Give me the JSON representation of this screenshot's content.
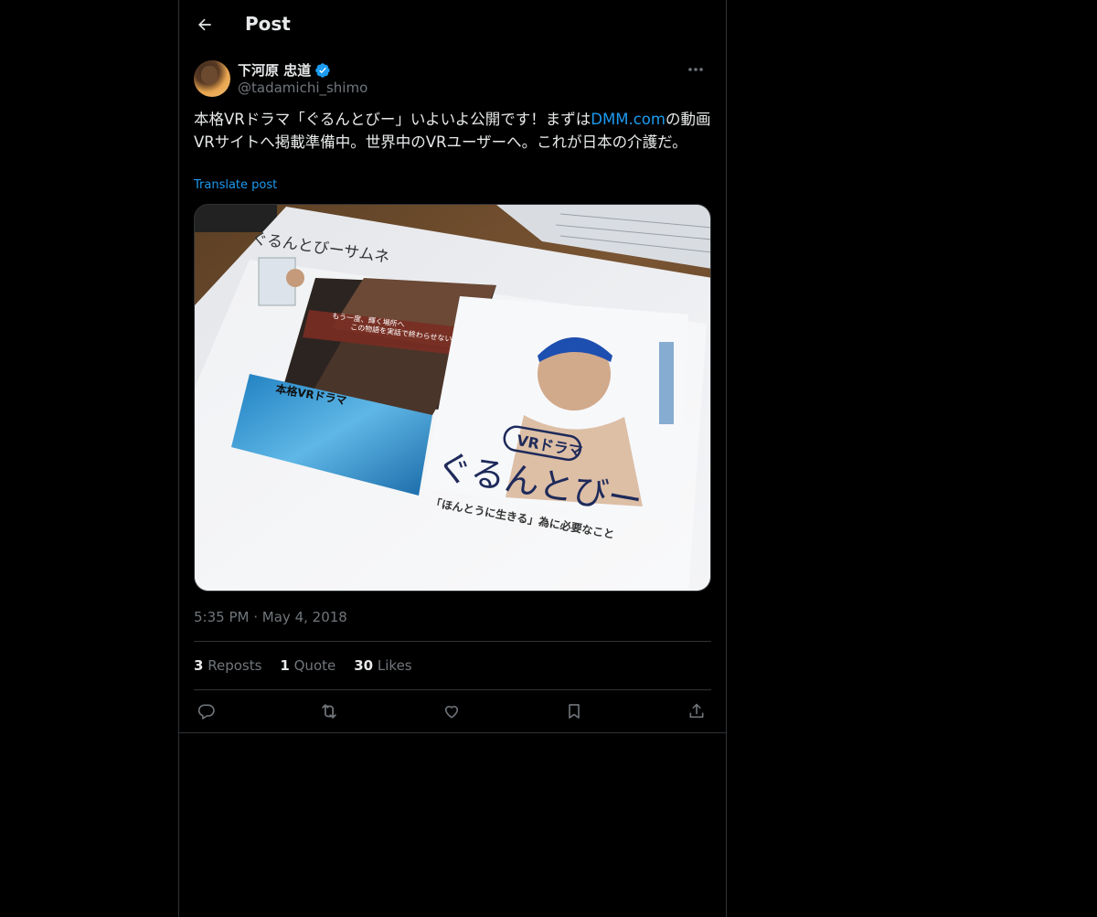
{
  "header": {
    "title": "Post"
  },
  "author": {
    "display_name": "下河原 忠道",
    "handle": "@tadamichi_shimo",
    "verified_icon": "verified-badge-icon"
  },
  "post": {
    "text_before_link": "本格VRドラマ「ぐるんとびー」いよいよ公開です！まずは",
    "link_text": "DMM.com",
    "text_after_link": "の動画VRサイトへ掲載準備中。世界中のVRユーザーへ。これが日本の介護だ。",
    "translate_label": "Translate post"
  },
  "media": {
    "photo_texts": {
      "sheet_title": "ぐるんとびーサムネ",
      "badge": "VRドラマ",
      "main_title": "ぐるんとびー",
      "tagline": "「ほんとうに生きる」為に必要なこと",
      "left_heading": "本格VRドラマ",
      "banner_line1": "もう一度、輝く場所へ",
      "banner_line2": "この物語を実話で終わらせない"
    }
  },
  "meta": {
    "time": "5:35 PM",
    "separator": "·",
    "date": "May 4, 2018"
  },
  "stats": {
    "reposts_count": "3",
    "reposts_label": "Reposts",
    "quotes_count": "1",
    "quotes_label": "Quote",
    "likes_count": "30",
    "likes_label": "Likes"
  },
  "colors": {
    "background": "#000000",
    "text": "#e7e9ea",
    "muted": "#71767b",
    "accent": "#1d9bf0",
    "border": "#2f3336"
  }
}
